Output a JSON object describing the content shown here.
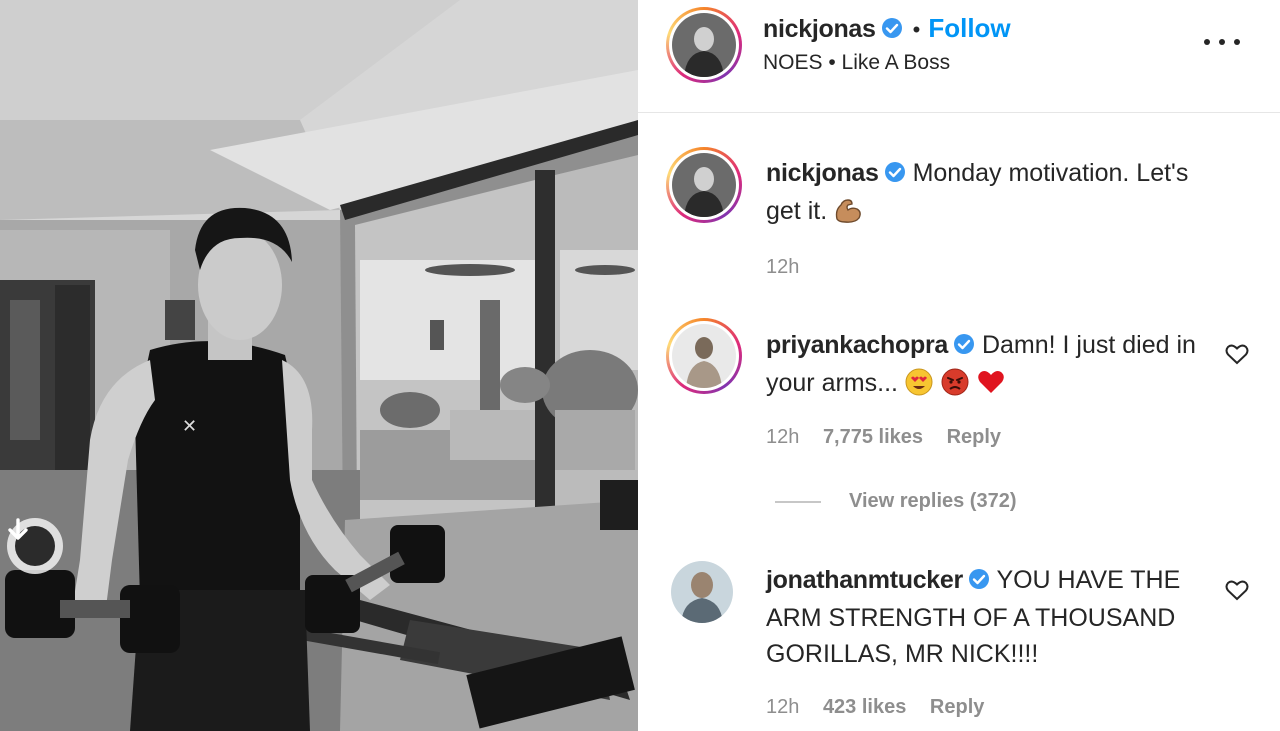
{
  "post": {
    "username": "nickjonas",
    "separator": "•",
    "follow_label": "Follow",
    "location": "NOES • Like A Boss"
  },
  "caption": {
    "username": "nickjonas",
    "text": "Monday motivation. Let's get it.",
    "emoji": "flexed-biceps",
    "time": "12h"
  },
  "comments": [
    {
      "username": "priyankachopra",
      "text": "Damn! I just died in your arms...",
      "emojis": [
        "heart-eyes",
        "angry-face",
        "red-heart"
      ],
      "time": "12h",
      "likes": "7,775 likes",
      "reply_label": "Reply"
    },
    {
      "username": "jonathanmtucker",
      "text": "YOU HAVE THE ARM STRENGTH OF A THOUSAND GORILLAS, MR NICK!!!!",
      "time": "12h",
      "likes": "423 likes",
      "reply_label": "Reply"
    }
  ],
  "view_replies_label": "View replies (372)",
  "colors": {
    "accent": "#0095f6",
    "text": "#262626",
    "muted": "#8e8e8e",
    "verified": "#3897f0",
    "heart": "#ed4956"
  },
  "icons": {
    "more": "more-options-icon",
    "verified": "verified-badge-icon",
    "like": "heart-outline-icon",
    "download": "download-arrow-icon"
  }
}
